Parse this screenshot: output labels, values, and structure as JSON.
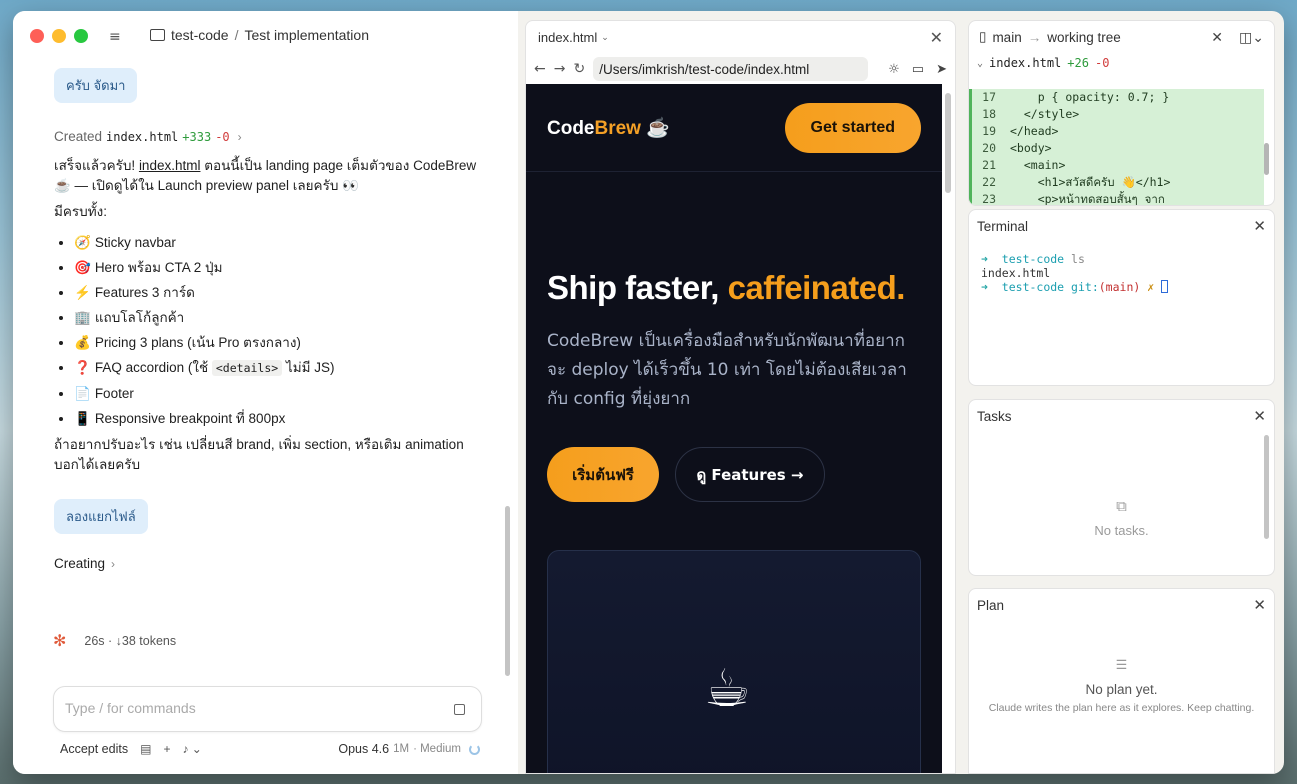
{
  "window": {
    "breadcrumb": {
      "project": "test-code",
      "separator": "/",
      "title": "Test implementation"
    }
  },
  "chat": {
    "messages": {
      "user1": "ครับ จัดมา",
      "created": {
        "label": "Created",
        "file": "index.html",
        "added": "+333",
        "removed": "-0"
      },
      "para1_prefix": "เสร็จแล้วครับ!",
      "para1_link": "index.html",
      "para1_rest": "ตอนนี้เป็น landing page เต็มตัวของ CodeBrew ☕ — เปิดดูได้ใน Launch preview panel เลยครับ 👀",
      "para2": "มีครบทั้ง:",
      "features": [
        {
          "emoji": "🧭",
          "text": "Sticky navbar"
        },
        {
          "emoji": "🎯",
          "text": "Hero พร้อม CTA 2 ปุ่ม"
        },
        {
          "emoji": "⚡",
          "text": "Features 3 การ์ด"
        },
        {
          "emoji": "🏢",
          "text": "แถบโลโก้ลูกค้า"
        },
        {
          "emoji": "💰",
          "text": "Pricing 3 plans (เน้น Pro ตรงกลาง)"
        },
        {
          "emoji": "❓",
          "text_before": "FAQ accordion (ใช้",
          "code": "<details>",
          "text_after": "ไม่มี JS)"
        },
        {
          "emoji": "📄",
          "text": "Footer"
        },
        {
          "emoji": "📱",
          "text": "Responsive breakpoint ที่ 800px"
        }
      ],
      "para3": "ถ้าอยากปรับอะไร เช่น เปลี่ยนสี brand, เพิ่ม section, หรือเติม animation บอกได้เลยครับ",
      "user2": "ลองแยกไฟล์",
      "creating": "Creating"
    },
    "status": {
      "elapsed": "26s",
      "tokens": "↓38 tokens"
    },
    "input": {
      "placeholder": "Type / for commands"
    },
    "toolbar": {
      "mode": "Accept edits",
      "model": "Opus 4.6",
      "context": "1M",
      "effort": "· Medium"
    }
  },
  "preview": {
    "tab": "index.html",
    "url": "/Users/imkrish/test-code/index.html",
    "site": {
      "logo_code": "Code",
      "logo_brew": "Brew",
      "logo_cup": "☕",
      "nav_cta": "Get started",
      "hero_title_plain": "Ship faster,",
      "hero_title_accent": "caffeinated.",
      "hero_sub": "CodeBrew เป็นเครื่องมือสำหรับนักพัฒนาที่อยากจะ deploy ได้เร็วขึ้น 10 เท่า โดยไม่ต้องเสียเวลากับ config ที่ยุ่งยาก",
      "btn_primary": "เริ่มต้นฟรี",
      "btn_secondary": "ดู Features →",
      "card_cup": "☕"
    }
  },
  "diff": {
    "branch": "main",
    "target": "working tree",
    "file": "index.html",
    "added": "+26",
    "removed": "-0",
    "lines": [
      {
        "n": "17",
        "code": "    p { opacity: 0.7; }"
      },
      {
        "n": "18",
        "code": "  </style>"
      },
      {
        "n": "19",
        "code": "</head>"
      },
      {
        "n": "20",
        "code": "<body>"
      },
      {
        "n": "21",
        "code": "  <main>"
      },
      {
        "n": "22",
        "code": "    <h1>สวัสดีครับ 👋</h1>"
      },
      {
        "n": "23",
        "code": "    <p>หน้าทดสอบสั้นๆ จาก"
      }
    ]
  },
  "terminal": {
    "title": "Terminal",
    "line1_dir": "test-code",
    "line1_cmd": "ls",
    "line2": "index.html",
    "line3_dir": "test-code",
    "line3_git": "git:",
    "line3_branch": "(main)",
    "line3_mark": "✗"
  },
  "tasks": {
    "title": "Tasks",
    "empty": "No tasks."
  },
  "plan": {
    "title": "Plan",
    "empty_title": "No plan yet.",
    "empty_sub": "Claude writes the plan here as it explores. Keep chatting."
  }
}
